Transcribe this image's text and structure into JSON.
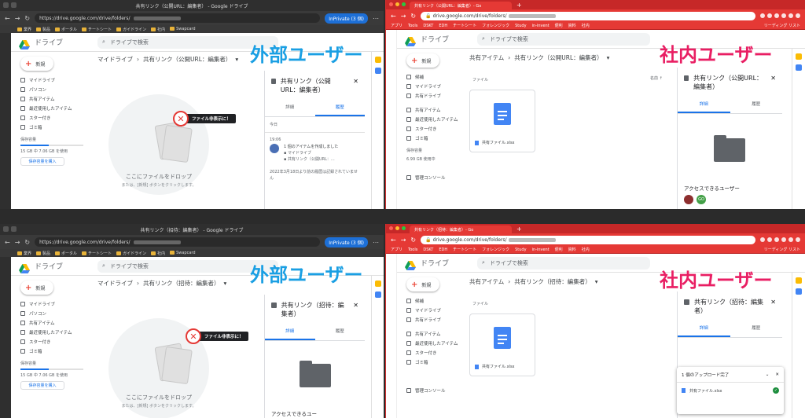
{
  "tl": {
    "window_title": "共有リンク（公開URL：編集者） - Google ドライブ",
    "url": "https://drive.google.com/drive/folders/",
    "inprivate": "InPrivate (3 個)",
    "bookmarks": [
      "業界",
      "製品",
      "ポータル",
      "チートシート",
      "ガイドライン",
      "社内",
      "Swapcard"
    ],
    "app_name": "ドライブ",
    "search_placeholder": "ドライブで検索",
    "breadcrumb_root": "マイドライブ",
    "breadcrumb_current": "共有リンク（公開URL：編集者）",
    "new_label": "新規",
    "nav": [
      "マイドライブ",
      "パソコン",
      "共有アイテム",
      "最近使用したアイテム",
      "スター付き",
      "ゴミ箱"
    ],
    "storage_label": "保存容量",
    "storage_used": "15 GB 中 7.06 GB を使用",
    "buy_storage": "保存容量を購入",
    "drop_text": "ここにファイルをドロップ",
    "drop_sub": "または、[新規] ボタンをクリックします。",
    "hidden_badge": "ファイル非表示に！",
    "overlay_label": "外部ユーザー",
    "panel_title": "共有リンク（公開URL：編集者）",
    "tab_details": "詳細",
    "tab_activity": "履歴",
    "today": "今日",
    "time": "19:06",
    "activity_text": "1 個のアイテムを作成しました",
    "activity_loc": "マイドライブ",
    "activity_item": "共有リンク（公開URL：...",
    "activity_note": "2022年3月18日より前の履歴は記録されていません"
  },
  "tr": {
    "tab_title": "共有リンク（公開URL：編集者）- Go",
    "url": "drive.google.com/drive/folders/",
    "bookmarks": [
      "アプリ",
      "Tools",
      "DSKT",
      "EDH",
      "チートシート",
      "フォレンジック",
      "Study",
      "in-invent",
      "便利",
      "資料",
      "社内"
    ],
    "reading_list": "リーディング リスト",
    "app_name": "ドライブ",
    "search_placeholder": "ドライブで検索",
    "breadcrumb_root": "共有アイテム",
    "breadcrumb_current": "共有リンク（公開URL：編集者）",
    "new_label": "新規",
    "nav": [
      "候補",
      "マイドライブ",
      "共有ドライブ",
      "共有アイテム",
      "最近使用したアイテム",
      "スター付き",
      "ゴミ箱"
    ],
    "storage_label": "保存容量",
    "storage_used": "6.99 GB 使用中",
    "admin": "管理コンソール",
    "files_label": "ファイル",
    "sort_label": "名前",
    "file_name": "共有ファイル.xlsx",
    "overlay_label": "社内ユーザー",
    "panel_title": "共有リンク（公開URL：編集者）",
    "tab_details": "詳細",
    "tab_activity": "履歴",
    "access_label": "アクセスできるユーザー",
    "avatar2": "GO"
  },
  "bl": {
    "window_title": "共有リンク（招待：編集者） - Google ドライブ",
    "url": "https://drive.google.com/drive/folders/",
    "inprivate": "InPrivate (3 個)",
    "bookmarks": [
      "業界",
      "製品",
      "ポータル",
      "チートシート",
      "ガイドライン",
      "社内",
      "Swapcard"
    ],
    "app_name": "ドライブ",
    "search_placeholder": "ドライブで検索",
    "breadcrumb_root": "マイドライブ",
    "breadcrumb_current": "共有リンク（招待：編集者）",
    "new_label": "新規",
    "nav": [
      "マイドライブ",
      "パソコン",
      "共有アイテム",
      "最近使用したアイテム",
      "スター付き",
      "ゴミ箱"
    ],
    "storage_label": "保存容量",
    "storage_used": "15 GB 中 7.06 GB を使用",
    "buy_storage": "保存容量を購入",
    "drop_text": "ここにファイルをドロップ",
    "drop_sub": "または、[新規] ボタンをクリックします。",
    "hidden_badge": "ファイル非表示に！",
    "overlay_label": "外部ユーザー",
    "panel_title": "共有リンク（招待：編集者）",
    "tab_details": "詳細",
    "tab_activity": "履歴",
    "access_label": "アクセスできるユー"
  },
  "br": {
    "tab_title": "共有リンク（招待：編集者）- Go",
    "url": "drive.google.com/drive/folders/",
    "bookmarks": [
      "アプリ",
      "Tools",
      "DSKT",
      "EDH",
      "チートシート",
      "フォレンジック",
      "Study",
      "in-invent",
      "便利",
      "資料",
      "社内"
    ],
    "reading_list": "リーディング リスト",
    "app_name": "ドライブ",
    "search_placeholder": "ドライブで検索",
    "breadcrumb_root": "共有アイテム",
    "breadcrumb_current": "共有リンク（招待：編集者）",
    "new_label": "新規",
    "nav": [
      "候補",
      "マイドライブ",
      "共有ドライブ",
      "共有アイテム",
      "最近使用したアイテム",
      "スター付き",
      "ゴミ箱"
    ],
    "admin": "管理コンソール",
    "files_label": "ファイル",
    "file_name": "共有ファイル.xlsx",
    "overlay_label": "社内ユーザー",
    "panel_title": "共有リンク（招待：編集者）",
    "tab_details": "詳細",
    "tab_activity": "履歴",
    "upload_title": "1 個のアップロード完了",
    "upload_file": "共有ファイル.xlsx"
  },
  "colors": {
    "edge_bg": "#2f2f2f",
    "chrome_red": "#e53935",
    "drive_blue": "#1a73e8",
    "overlay_blue": "#1a9fe3",
    "overlay_pink": "#e91e63"
  }
}
